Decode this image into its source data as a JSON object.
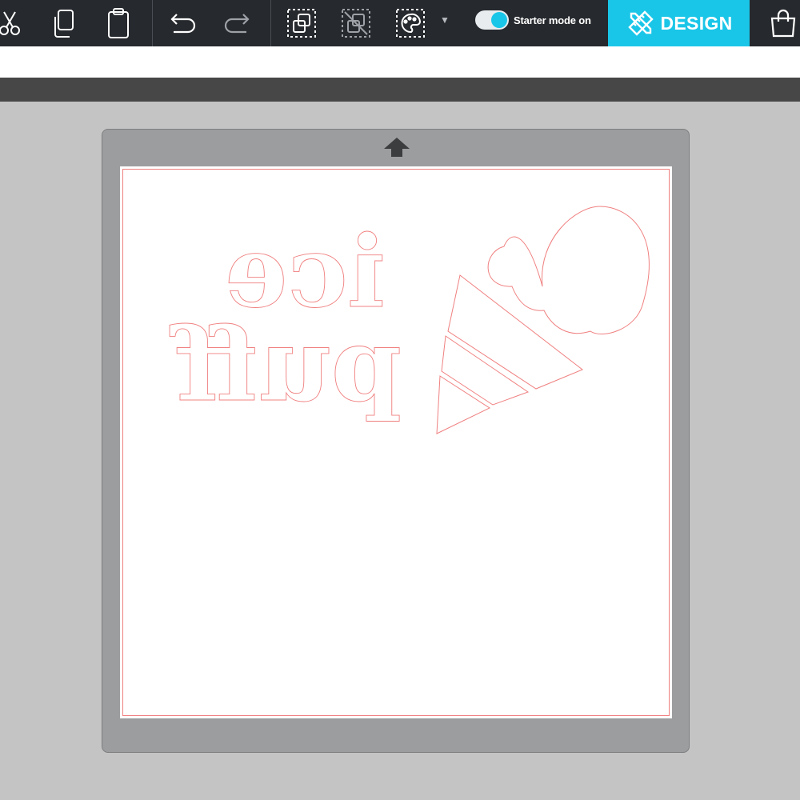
{
  "toolbar": {
    "icons": [
      {
        "name": "cut-icon"
      },
      {
        "name": "copy-icon"
      },
      {
        "name": "paste-icon"
      },
      {
        "name": "undo-icon"
      },
      {
        "name": "redo-icon"
      },
      {
        "name": "attach-icon"
      },
      {
        "name": "detach-icon"
      },
      {
        "name": "color-sync-icon"
      },
      {
        "name": "shop-bag-icon"
      }
    ],
    "starter_mode_label": "Starter mode on",
    "starter_mode_on": true,
    "design_tab_label": "DESIGN"
  },
  "colors": {
    "toolbar_bg": "#26292d",
    "accent": "#1ac6e8",
    "cut_line": "#f08080",
    "mat": "#9c9d9f",
    "workspace": "#c4c4c4"
  },
  "canvas": {
    "text_lines": [
      "ice",
      "puff"
    ],
    "mirrored": true,
    "graphic": "ice-cream-cone"
  }
}
